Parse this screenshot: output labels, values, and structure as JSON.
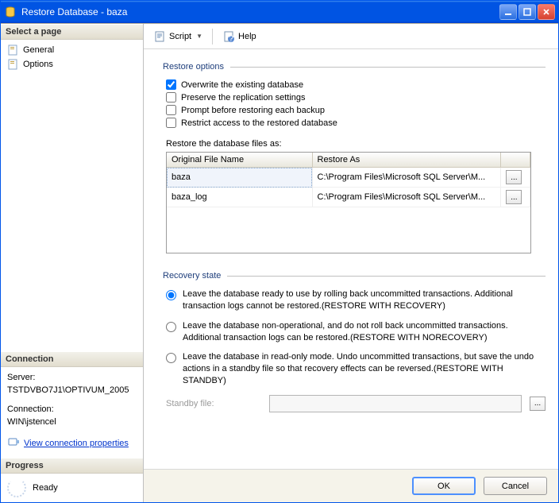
{
  "window": {
    "title": "Restore Database - baza"
  },
  "left": {
    "select_page": "Select a page",
    "pages": {
      "general": "General",
      "options": "Options"
    },
    "connection_head": "Connection",
    "server_label": "Server:",
    "server_value": "TSTDVBO7J1\\OPTIVUM_2005",
    "connection_label": "Connection:",
    "connection_value": "WIN\\jstencel",
    "view_conn": "View connection properties",
    "progress_head": "Progress",
    "progress_status": "Ready"
  },
  "toolbar": {
    "script": "Script",
    "help": "Help"
  },
  "restore": {
    "group": "Restore options",
    "overwrite": "Overwrite the existing database",
    "preserve": "Preserve the replication settings",
    "prompt": "Prompt before restoring each backup",
    "restrict": "Restrict access to the restored database",
    "subhead": "Restore the database files as:",
    "cols": {
      "orig": "Original File Name",
      "as": "Restore As"
    },
    "rows": [
      {
        "orig": "baza",
        "as": "C:\\Program Files\\Microsoft SQL Server\\M..."
      },
      {
        "orig": "baza_log",
        "as": "C:\\Program Files\\Microsoft SQL Server\\M..."
      }
    ]
  },
  "recovery": {
    "group": "Recovery state",
    "opt1": "Leave the database ready to use by rolling back uncommitted transactions. Additional transaction logs cannot be restored.(RESTORE WITH RECOVERY)",
    "opt2": "Leave the database non-operational, and do not roll back uncommitted transactions. Additional transaction logs can be restored.(RESTORE WITH NORECOVERY)",
    "opt3": "Leave the database in read-only mode. Undo uncommitted transactions, but save the undo actions in a standby file so that recovery effects can be reversed.(RESTORE WITH STANDBY)",
    "standby_label": "Standby file:",
    "standby_value": ""
  },
  "footer": {
    "ok": "OK",
    "cancel": "Cancel"
  }
}
